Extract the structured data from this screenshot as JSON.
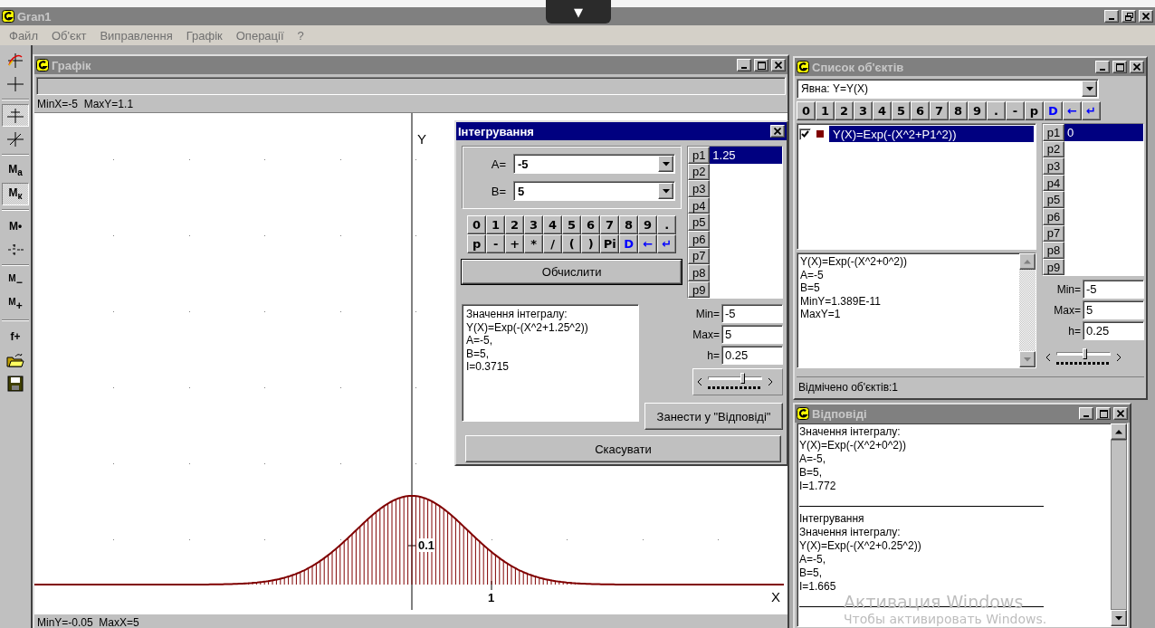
{
  "app": {
    "title": "Gran1",
    "top_tab": "▼"
  },
  "menu": [
    {
      "label": "Файл"
    },
    {
      "label": "Об'єкт"
    },
    {
      "label": "Виправлення"
    },
    {
      "label": "Графік"
    },
    {
      "label": "Операції"
    },
    {
      "label": "?"
    }
  ],
  "toolbar": [
    [
      {
        "kind": "curve",
        "pressed": false
      },
      {
        "kind": "cross",
        "pressed": false
      }
    ],
    [
      {
        "kind": "tee",
        "pressed": true
      },
      {
        "kind": "slant",
        "pressed": false
      }
    ],
    [
      {
        "kind": "text",
        "label": "M$_{a}$",
        "pressed": false
      },
      {
        "kind": "text",
        "label": "M$_{к}$",
        "pressed": true
      }
    ],
    [
      {
        "kind": "text",
        "label": "M•",
        "pressed": false
      },
      {
        "kind": "scale",
        "pressed": false
      }
    ],
    [
      {
        "kind": "text",
        "label": "$^{M}$−",
        "pressed": false
      },
      {
        "kind": "text",
        "label": "$^{M}$+",
        "pressed": false
      }
    ],
    [
      {
        "kind": "text",
        "label": "f+",
        "pressed": false
      },
      {
        "kind": "folder",
        "pressed": false
      },
      {
        "kind": "disk",
        "pressed": false
      }
    ]
  ],
  "graph": {
    "title": "Графік",
    "top_status": "MinX=-5  MaxY=1.1",
    "y_axis_label": "Y",
    "x_axis_label": "X",
    "x_tick_label": "1",
    "y_tick_label": "0.1",
    "bottom_status": "MinY=-0.05  MaxX=5"
  },
  "dialog": {
    "title": "Інтегрування",
    "a_label": "A=",
    "a_value": "-5",
    "b_label": "B=",
    "b_value": "5",
    "keys": [
      {
        "label": "0",
        "command": false
      },
      {
        "label": "1",
        "command": false
      },
      {
        "label": "2",
        "command": false
      },
      {
        "label": "3",
        "command": false
      },
      {
        "label": "4",
        "command": false
      },
      {
        "label": "5",
        "command": false
      },
      {
        "label": "6",
        "command": false
      },
      {
        "label": "7",
        "command": false
      },
      {
        "label": "8",
        "command": false
      },
      {
        "label": "9",
        "command": false
      },
      {
        "label": ".",
        "command": false
      },
      {
        "label": "p",
        "command": false
      },
      {
        "label": "-",
        "command": false
      },
      {
        "label": "+",
        "command": false
      },
      {
        "label": "*",
        "command": false
      },
      {
        "label": "/",
        "command": false
      },
      {
        "label": "(",
        "command": false
      },
      {
        "label": ")",
        "command": false
      },
      {
        "label": "Pi",
        "command": false
      },
      {
        "label": "D",
        "command": true
      },
      {
        "label": "←",
        "command": true
      },
      {
        "label": "↵",
        "command": true
      }
    ],
    "compute_button": "Обчислити",
    "result_lines": [
      "Значення інтегралу:",
      "Y(X)=Exp(-(X^2+1.25^2))",
      "A=-5,",
      "B=5,",
      "I=0.3715"
    ],
    "params": [
      {
        "name": "p1",
        "value": "1.25",
        "selected": true
      },
      {
        "name": "p2",
        "selected": false
      },
      {
        "name": "p3",
        "selected": false
      },
      {
        "name": "p4",
        "selected": false
      },
      {
        "name": "p5",
        "selected": false
      },
      {
        "name": "p6",
        "selected": false
      },
      {
        "name": "p7",
        "selected": false
      },
      {
        "name": "p8",
        "selected": false
      },
      {
        "name": "p9",
        "selected": false
      }
    ],
    "min_label": "Min=",
    "min_value": "-5",
    "max_label": "Max=",
    "max_value": "5",
    "h_label": "h=",
    "h_value": "0.25",
    "slider": {
      "level": 0.64
    },
    "store_button": "Занести у \"Відповіді\"",
    "cancel_button": "Скасувати"
  },
  "objects": {
    "title": "Список об'єктів",
    "type_select": "Явна: Y=Y(X)",
    "keys": [
      {
        "label": "0",
        "command": false
      },
      {
        "label": "1",
        "command": false
      },
      {
        "label": "2",
        "command": false
      },
      {
        "label": "3",
        "command": false
      },
      {
        "label": "4",
        "command": false
      },
      {
        "label": "5",
        "command": false
      },
      {
        "label": "6",
        "command": false
      },
      {
        "label": "7",
        "command": false
      },
      {
        "label": "8",
        "command": false
      },
      {
        "label": "9",
        "command": false
      },
      {
        "label": ".",
        "command": false
      },
      {
        "label": "-",
        "command": false
      },
      {
        "label": "p",
        "command": false
      },
      {
        "label": "D",
        "command": true
      },
      {
        "label": "←",
        "command": true
      },
      {
        "label": "↵",
        "command": true
      }
    ],
    "items": [
      {
        "formula": "Y(X)=Exp(-(X^2+P1^2))",
        "checked": true,
        "selected": true,
        "color": "#800000"
      }
    ],
    "info_lines": [
      "Y(X)=Exp(-(X^2+0^2))",
      "A=-5",
      "B=5",
      "MinY=1.389E-11",
      "MaxY=1"
    ],
    "params": [
      {
        "name": "p1",
        "value": "0",
        "selected": true
      },
      {
        "name": "p2",
        "selected": false
      },
      {
        "name": "p3",
        "selected": false
      },
      {
        "name": "p4",
        "selected": false
      },
      {
        "name": "p5",
        "selected": false
      },
      {
        "name": "p6",
        "selected": false
      },
      {
        "name": "p7",
        "selected": false
      },
      {
        "name": "p8",
        "selected": false
      },
      {
        "name": "p9",
        "selected": false
      }
    ],
    "min_label": "Min=",
    "min_value": "-5",
    "max_label": "Max=",
    "max_value": "5",
    "h_label": "h=",
    "h_value": "0.25",
    "slider": {
      "level": 0.52
    },
    "status": "Відмічено об'єктів:1"
  },
  "answers": {
    "title": "Відповіді",
    "entries": [
      {
        "lines": [
          "Значення інтегралу:",
          "Y(X)=Exp(-(X^2+0^2))",
          "A=-5,",
          "B=5,",
          "I=1.772"
        ]
      },
      {
        "lines": [
          "Інтегрування",
          "Значення інтегралу:",
          "Y(X)=Exp(-(X^2+0.25^2))",
          "A=-5,",
          "B=5,",
          "I=1.665"
        ]
      }
    ]
  },
  "os_notice": {
    "heading": "Активация Windows",
    "text": "Чтобы активировать Windows."
  }
}
